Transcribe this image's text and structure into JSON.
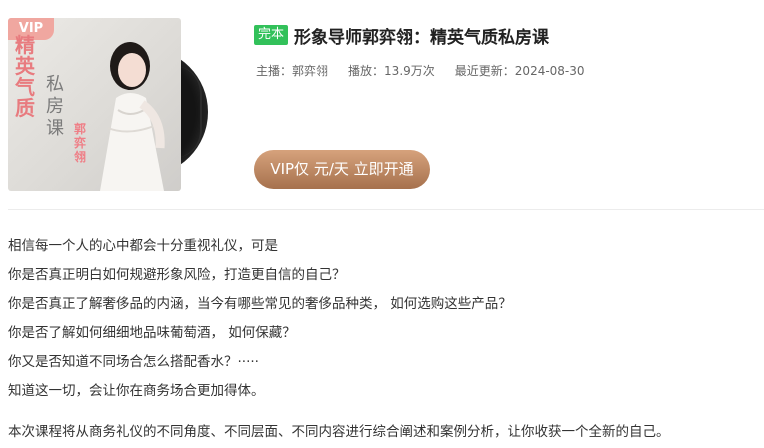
{
  "cover": {
    "badge": "VIP",
    "title_text": "精英气质",
    "subtitle_text": "私房课",
    "name_text": "郭弈翎"
  },
  "course": {
    "tag": "完本",
    "title": "形象导师郭弈翎：精英气质私房课"
  },
  "meta": {
    "host_label": "主播：",
    "host": "郭弈翎",
    "plays_label": "播放：",
    "plays": "13.9万次",
    "updated_label": "最近更新：",
    "updated": "2024-08-30"
  },
  "action": {
    "vip_button": "VIP仅 元/天 立即开通"
  },
  "description": {
    "lines": [
      "相信每一个人的心中都会十分重视礼仪，可是",
      "你是否真正明白如何规避形象风险，打造更自信的自己？",
      "你是否真正了解奢侈品的内涵，当今有哪些常见的奢侈品种类，  如何选购这些产品？",
      "你是否了解如何细细地品味葡萄酒，  如何保藏？",
      "你又是否知道不同场合怎么搭配香水？·····",
      "知道这一切，会让你在商务场合更加得体。"
    ],
    "summary": "本次课程将从商务礼仪的不同角度、不同层面、不同内容进行综合阐述和案例分析，让你收获一个全新的自己。"
  }
}
